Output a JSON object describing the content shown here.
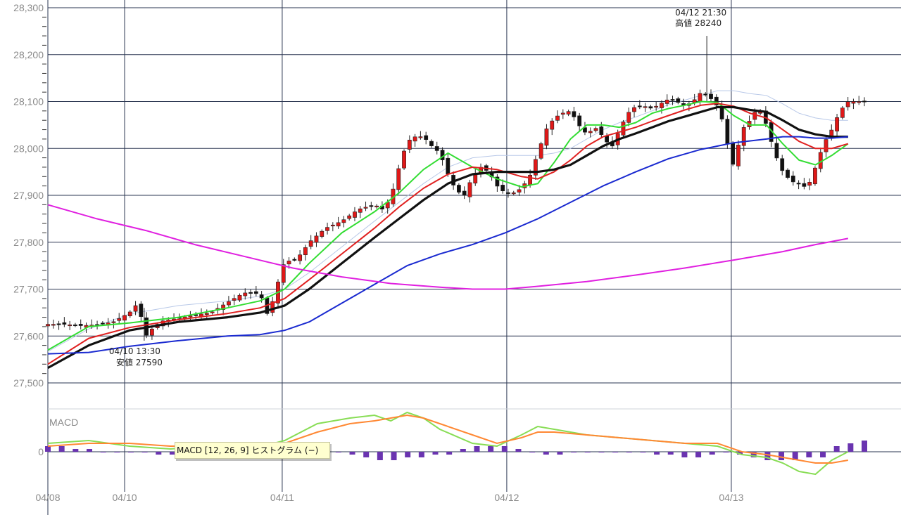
{
  "chart_data": {
    "type": "candlestick",
    "y_axis": {
      "ticks": [
        "28,300",
        "28,200",
        "28,100",
        "28,000",
        "27,900",
        "27,800",
        "27,700",
        "27,600",
        "27,500"
      ],
      "range": [
        27440,
        28310
      ]
    },
    "x_axis": {
      "labels": [
        {
          "text": "04/08",
          "pos": 0.0
        },
        {
          "text": "04/10",
          "pos": 0.094
        },
        {
          "text": "04/11",
          "pos": 0.287
        },
        {
          "text": "04/12",
          "pos": 0.562
        },
        {
          "text": "04/13",
          "pos": 0.837
        }
      ]
    },
    "annotations": {
      "high": {
        "time": "04/12 21:30",
        "label": "高値 28240",
        "value": 28240,
        "pos": 0.807
      },
      "low": {
        "time": "04/10 13:30",
        "label": "安値 27590",
        "value": 27590,
        "pos": 0.118
      }
    },
    "macd": {
      "title": "MACD",
      "zero_label": "0",
      "tooltip": "MACD [12, 26, 9] ヒストグラム (−)"
    },
    "price_path": [
      [
        0.0,
        27625
      ],
      [
        0.02,
        27625
      ],
      [
        0.04,
        27622
      ],
      [
        0.06,
        27624
      ],
      [
        0.08,
        27630
      ],
      [
        0.1,
        27650
      ],
      [
        0.11,
        27670
      ],
      [
        0.12,
        27600
      ],
      [
        0.13,
        27620
      ],
      [
        0.14,
        27632
      ],
      [
        0.16,
        27638
      ],
      [
        0.18,
        27645
      ],
      [
        0.2,
        27650
      ],
      [
        0.22,
        27672
      ],
      [
        0.24,
        27692
      ],
      [
        0.26,
        27690
      ],
      [
        0.27,
        27640
      ],
      [
        0.28,
        27705
      ],
      [
        0.29,
        27760
      ],
      [
        0.3,
        27760
      ],
      [
        0.31,
        27775
      ],
      [
        0.32,
        27800
      ],
      [
        0.33,
        27815
      ],
      [
        0.34,
        27830
      ],
      [
        0.36,
        27845
      ],
      [
        0.38,
        27870
      ],
      [
        0.39,
        27875
      ],
      [
        0.4,
        27880
      ],
      [
        0.41,
        27870
      ],
      [
        0.42,
        27895
      ],
      [
        0.43,
        27960
      ],
      [
        0.44,
        28015
      ],
      [
        0.45,
        28025
      ],
      [
        0.46,
        28025
      ],
      [
        0.47,
        28005
      ],
      [
        0.48,
        27990
      ],
      [
        0.49,
        27945
      ],
      [
        0.5,
        27910
      ],
      [
        0.51,
        27900
      ],
      [
        0.52,
        27940
      ],
      [
        0.53,
        27960
      ],
      [
        0.54,
        27950
      ],
      [
        0.55,
        27920
      ],
      [
        0.56,
        27905
      ],
      [
        0.57,
        27905
      ],
      [
        0.58,
        27915
      ],
      [
        0.59,
        27940
      ],
      [
        0.6,
        27990
      ],
      [
        0.61,
        28040
      ],
      [
        0.62,
        28065
      ],
      [
        0.63,
        28075
      ],
      [
        0.64,
        28080
      ],
      [
        0.65,
        28050
      ],
      [
        0.66,
        28030
      ],
      [
        0.67,
        28045
      ],
      [
        0.68,
        28025
      ],
      [
        0.69,
        28000
      ],
      [
        0.7,
        28040
      ],
      [
        0.71,
        28075
      ],
      [
        0.72,
        28090
      ],
      [
        0.73,
        28090
      ],
      [
        0.74,
        28085
      ],
      [
        0.75,
        28095
      ],
      [
        0.76,
        28105
      ],
      [
        0.77,
        28100
      ],
      [
        0.78,
        28090
      ],
      [
        0.79,
        28100
      ],
      [
        0.8,
        28120
      ],
      [
        0.81,
        28110
      ],
      [
        0.82,
        28090
      ],
      [
        0.83,
        28040
      ],
      [
        0.835,
        27970
      ],
      [
        0.84,
        27965
      ],
      [
        0.85,
        28040
      ],
      [
        0.86,
        28060
      ],
      [
        0.87,
        28090
      ],
      [
        0.88,
        28050
      ],
      [
        0.89,
        27990
      ],
      [
        0.9,
        27950
      ],
      [
        0.91,
        27930
      ],
      [
        0.92,
        27925
      ],
      [
        0.93,
        27915
      ],
      [
        0.94,
        27960
      ],
      [
        0.95,
        28010
      ],
      [
        0.96,
        28040
      ],
      [
        0.97,
        28080
      ],
      [
        0.98,
        28100
      ]
    ],
    "series": [
      {
        "name": "",
        "color": "#33dd33",
        "points": [
          [
            0.0,
            27570
          ],
          [
            0.05,
            27620
          ],
          [
            0.1,
            27628
          ],
          [
            0.16,
            27640
          ],
          [
            0.22,
            27660
          ],
          [
            0.26,
            27675
          ],
          [
            0.29,
            27700
          ],
          [
            0.32,
            27755
          ],
          [
            0.36,
            27820
          ],
          [
            0.4,
            27865
          ],
          [
            0.43,
            27905
          ],
          [
            0.46,
            27955
          ],
          [
            0.49,
            27990
          ],
          [
            0.52,
            27960
          ],
          [
            0.55,
            27935
          ],
          [
            0.58,
            27918
          ],
          [
            0.6,
            27925
          ],
          [
            0.62,
            27970
          ],
          [
            0.64,
            28020
          ],
          [
            0.66,
            28050
          ],
          [
            0.68,
            28050
          ],
          [
            0.7,
            28045
          ],
          [
            0.72,
            28055
          ],
          [
            0.74,
            28075
          ],
          [
            0.76,
            28085
          ],
          [
            0.78,
            28092
          ],
          [
            0.8,
            28100
          ],
          [
            0.82,
            28098
          ],
          [
            0.84,
            28070
          ],
          [
            0.86,
            28050
          ],
          [
            0.88,
            28050
          ],
          [
            0.9,
            28010
          ],
          [
            0.92,
            27975
          ],
          [
            0.94,
            27965
          ],
          [
            0.96,
            27985
          ],
          [
            0.98,
            28010
          ]
        ]
      },
      {
        "name": "",
        "color": "#e02020",
        "points": [
          [
            0.0,
            27540
          ],
          [
            0.05,
            27595
          ],
          [
            0.1,
            27618
          ],
          [
            0.16,
            27635
          ],
          [
            0.22,
            27648
          ],
          [
            0.26,
            27660
          ],
          [
            0.29,
            27680
          ],
          [
            0.32,
            27720
          ],
          [
            0.36,
            27775
          ],
          [
            0.4,
            27830
          ],
          [
            0.43,
            27875
          ],
          [
            0.46,
            27915
          ],
          [
            0.49,
            27945
          ],
          [
            0.52,
            27960
          ],
          [
            0.55,
            27955
          ],
          [
            0.58,
            27940
          ],
          [
            0.6,
            27935
          ],
          [
            0.62,
            27950
          ],
          [
            0.64,
            27975
          ],
          [
            0.66,
            28005
          ],
          [
            0.68,
            28025
          ],
          [
            0.7,
            28035
          ],
          [
            0.72,
            28045
          ],
          [
            0.74,
            28058
          ],
          [
            0.76,
            28070
          ],
          [
            0.78,
            28082
          ],
          [
            0.8,
            28092
          ],
          [
            0.82,
            28096
          ],
          [
            0.84,
            28090
          ],
          [
            0.86,
            28075
          ],
          [
            0.88,
            28065
          ],
          [
            0.9,
            28040
          ],
          [
            0.92,
            28015
          ],
          [
            0.94,
            28000
          ],
          [
            0.96,
            28000
          ],
          [
            0.98,
            28010
          ]
        ]
      },
      {
        "name": "",
        "color": "#111111",
        "points": [
          [
            0.0,
            27532
          ],
          [
            0.05,
            27580
          ],
          [
            0.1,
            27612
          ],
          [
            0.16,
            27630
          ],
          [
            0.22,
            27640
          ],
          [
            0.26,
            27650
          ],
          [
            0.29,
            27665
          ],
          [
            0.32,
            27700
          ],
          [
            0.36,
            27755
          ],
          [
            0.4,
            27810
          ],
          [
            0.43,
            27850
          ],
          [
            0.46,
            27890
          ],
          [
            0.49,
            27925
          ],
          [
            0.52,
            27945
          ],
          [
            0.55,
            27950
          ],
          [
            0.58,
            27950
          ],
          [
            0.6,
            27950
          ],
          [
            0.62,
            27955
          ],
          [
            0.64,
            27965
          ],
          [
            0.66,
            27985
          ],
          [
            0.68,
            28005
          ],
          [
            0.7,
            28020
          ],
          [
            0.72,
            28032
          ],
          [
            0.74,
            28045
          ],
          [
            0.76,
            28058
          ],
          [
            0.78,
            28068
          ],
          [
            0.8,
            28078
          ],
          [
            0.82,
            28088
          ],
          [
            0.84,
            28088
          ],
          [
            0.86,
            28082
          ],
          [
            0.88,
            28078
          ],
          [
            0.9,
            28060
          ],
          [
            0.92,
            28040
          ],
          [
            0.94,
            28030
          ],
          [
            0.96,
            28025
          ],
          [
            0.98,
            28025
          ]
        ]
      },
      {
        "name": "",
        "color": "#1a2ad0",
        "points": [
          [
            0.0,
            27562
          ],
          [
            0.05,
            27565
          ],
          [
            0.1,
            27578
          ],
          [
            0.16,
            27590
          ],
          [
            0.22,
            27600
          ],
          [
            0.26,
            27603
          ],
          [
            0.29,
            27612
          ],
          [
            0.32,
            27630
          ],
          [
            0.36,
            27670
          ],
          [
            0.4,
            27710
          ],
          [
            0.44,
            27750
          ],
          [
            0.48,
            27775
          ],
          [
            0.52,
            27795
          ],
          [
            0.56,
            27820
          ],
          [
            0.6,
            27850
          ],
          [
            0.64,
            27885
          ],
          [
            0.68,
            27920
          ],
          [
            0.72,
            27950
          ],
          [
            0.76,
            27978
          ],
          [
            0.8,
            27998
          ],
          [
            0.84,
            28012
          ],
          [
            0.88,
            28020
          ],
          [
            0.9,
            28025
          ],
          [
            0.92,
            28025
          ],
          [
            0.94,
            28022
          ],
          [
            0.96,
            28022
          ],
          [
            0.98,
            28025
          ]
        ]
      },
      {
        "name": "",
        "color": "#e020e0",
        "points": [
          [
            0.0,
            27880
          ],
          [
            0.06,
            27850
          ],
          [
            0.12,
            27825
          ],
          [
            0.18,
            27795
          ],
          [
            0.24,
            27770
          ],
          [
            0.3,
            27745
          ],
          [
            0.36,
            27726
          ],
          [
            0.42,
            27712
          ],
          [
            0.48,
            27704
          ],
          [
            0.52,
            27700
          ],
          [
            0.56,
            27700
          ],
          [
            0.6,
            27706
          ],
          [
            0.66,
            27716
          ],
          [
            0.72,
            27730
          ],
          [
            0.78,
            27745
          ],
          [
            0.84,
            27762
          ],
          [
            0.9,
            27780
          ],
          [
            0.94,
            27795
          ],
          [
            0.98,
            27808
          ]
        ]
      }
    ],
    "macd_lines": [
      {
        "name": "",
        "color": "#88dd55",
        "points": [
          [
            0.0,
            3
          ],
          [
            0.05,
            4
          ],
          [
            0.1,
            2
          ],
          [
            0.15,
            1
          ],
          [
            0.2,
            2
          ],
          [
            0.25,
            1
          ],
          [
            0.29,
            4
          ],
          [
            0.33,
            10
          ],
          [
            0.37,
            12
          ],
          [
            0.4,
            13
          ],
          [
            0.42,
            11
          ],
          [
            0.44,
            14
          ],
          [
            0.46,
            12
          ],
          [
            0.48,
            8
          ],
          [
            0.52,
            3
          ],
          [
            0.55,
            2
          ],
          [
            0.58,
            6
          ],
          [
            0.6,
            9
          ],
          [
            0.62,
            8
          ],
          [
            0.66,
            6
          ],
          [
            0.7,
            5
          ],
          [
            0.74,
            4
          ],
          [
            0.78,
            3
          ],
          [
            0.82,
            2
          ],
          [
            0.85,
            -1
          ],
          [
            0.88,
            -2
          ],
          [
            0.9,
            -4
          ],
          [
            0.92,
            -7
          ],
          [
            0.94,
            -8
          ],
          [
            0.96,
            -3
          ],
          [
            0.98,
            0
          ]
        ]
      },
      {
        "name": "",
        "color": "#ff8833",
        "points": [
          [
            0.0,
            2
          ],
          [
            0.05,
            3
          ],
          [
            0.1,
            3
          ],
          [
            0.15,
            2
          ],
          [
            0.2,
            2
          ],
          [
            0.25,
            2
          ],
          [
            0.29,
            3
          ],
          [
            0.33,
            7
          ],
          [
            0.37,
            10
          ],
          [
            0.4,
            11
          ],
          [
            0.42,
            12
          ],
          [
            0.44,
            13
          ],
          [
            0.46,
            12
          ],
          [
            0.48,
            10
          ],
          [
            0.52,
            6
          ],
          [
            0.55,
            3
          ],
          [
            0.58,
            5
          ],
          [
            0.6,
            7
          ],
          [
            0.62,
            7
          ],
          [
            0.66,
            6
          ],
          [
            0.7,
            5
          ],
          [
            0.74,
            4
          ],
          [
            0.78,
            3
          ],
          [
            0.82,
            3
          ],
          [
            0.85,
            0
          ],
          [
            0.88,
            -1
          ],
          [
            0.9,
            -2
          ],
          [
            0.92,
            -3
          ],
          [
            0.94,
            -4
          ],
          [
            0.96,
            -4
          ],
          [
            0.98,
            -3
          ]
        ]
      }
    ],
    "macd_hist": [
      2,
      2,
      1,
      1,
      0,
      0,
      0,
      0,
      -1,
      -1,
      0,
      0,
      0,
      0,
      1,
      1,
      2,
      2,
      2,
      1,
      1,
      0,
      -1,
      -2,
      -3,
      -3,
      -2,
      -2,
      -1,
      -1,
      1,
      2,
      2,
      2,
      1,
      0,
      -1,
      -1,
      0,
      0,
      0,
      0,
      0,
      0,
      -1,
      -1,
      -2,
      -2,
      -1,
      0,
      -1,
      -2,
      -3,
      -3,
      -3,
      -2,
      -2,
      2,
      3,
      4
    ]
  }
}
